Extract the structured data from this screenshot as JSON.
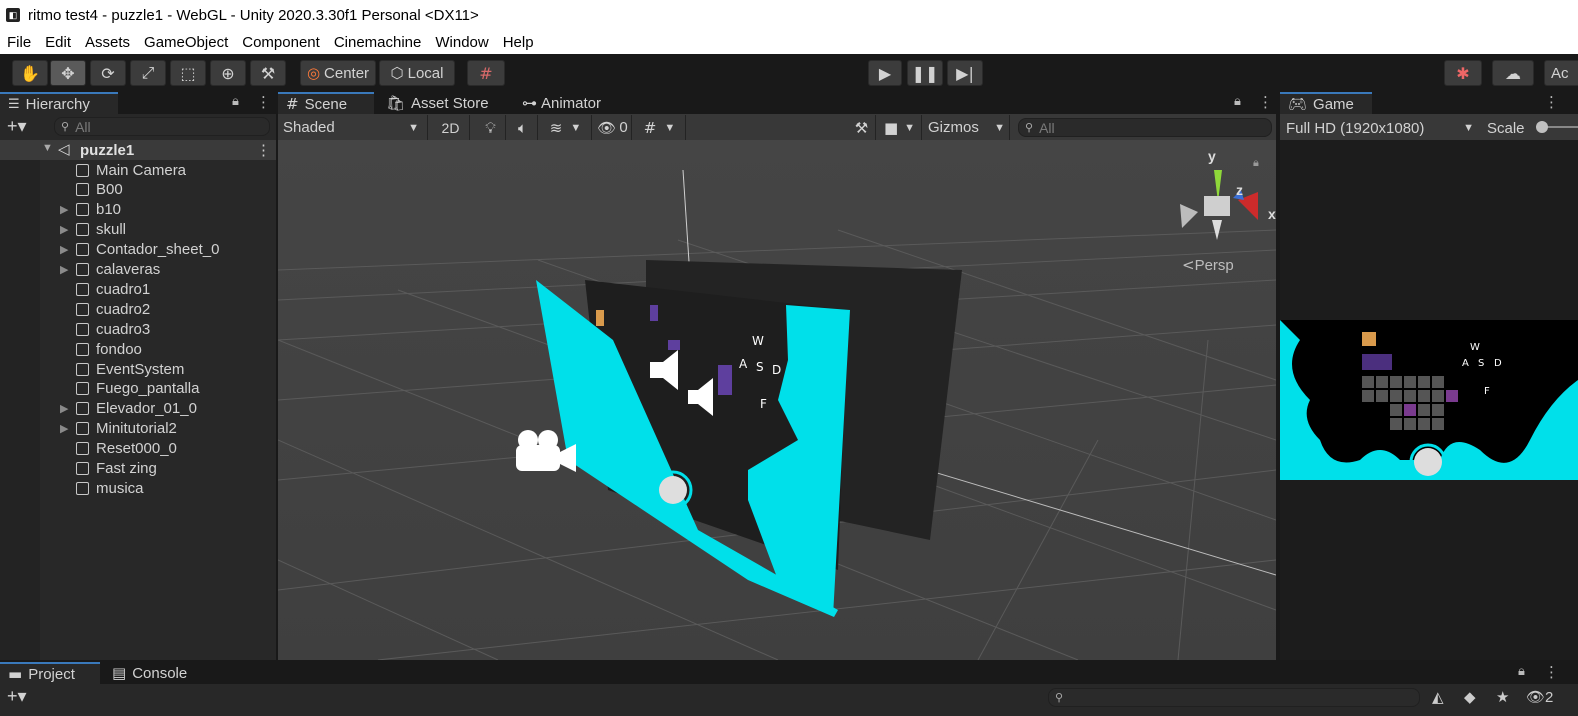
{
  "window": {
    "title": "ritmo test4 - puzzle1 - WebGL - Unity 2020.3.30f1 Personal <DX11>"
  },
  "menu": [
    "File",
    "Edit",
    "Assets",
    "GameObject",
    "Component",
    "Cinemachine",
    "Window",
    "Help"
  ],
  "toolbar": {
    "center_label": "Center",
    "local_label": "Local",
    "account_label": "Ac"
  },
  "hierarchy": {
    "tab_label": "Hierarchy",
    "search_placeholder": "All",
    "scene_name": "puzzle1",
    "items": [
      {
        "label": "Main Camera",
        "expandable": false
      },
      {
        "label": "B00",
        "expandable": false
      },
      {
        "label": "b10",
        "expandable": true
      },
      {
        "label": "skull",
        "expandable": true
      },
      {
        "label": "Contador_sheet_0",
        "expandable": true
      },
      {
        "label": "calaveras",
        "expandable": true
      },
      {
        "label": "cuadro1",
        "expandable": false
      },
      {
        "label": "cuadro2",
        "expandable": false
      },
      {
        "label": "cuadro3",
        "expandable": false
      },
      {
        "label": "fondoo",
        "expandable": false
      },
      {
        "label": "EventSystem",
        "expandable": false
      },
      {
        "label": "Fuego_pantalla",
        "expandable": false
      },
      {
        "label": "Elevador_01_0",
        "expandable": true
      },
      {
        "label": "Minitutorial2",
        "expandable": true
      },
      {
        "label": "Reset000_0",
        "expandable": false
      },
      {
        "label": "Fast zing",
        "expandable": false
      },
      {
        "label": "musica",
        "expandable": false
      }
    ]
  },
  "scene": {
    "tabs": [
      "Scene",
      "Asset Store",
      "Animator"
    ],
    "shading_mode": "Shaded",
    "mode_2d": "2D",
    "hidden_count": "0",
    "gizmos_label": "Gizmos",
    "search_placeholder": "All",
    "projection_label": "Persp",
    "axis_y": "y",
    "axis_x": "x",
    "axis_z": "z"
  },
  "game": {
    "tab_label": "Game",
    "resolution": "Full HD (1920x1080)",
    "scale_label": "Scale",
    "game_texts": [
      "W",
      "A",
      "S",
      "D",
      "F"
    ]
  },
  "bottom": {
    "tabs": [
      "Project",
      "Console"
    ],
    "hidden_count": "2"
  },
  "colors": {
    "cyan": "#00e0ea",
    "accent": "#3a79bb"
  }
}
